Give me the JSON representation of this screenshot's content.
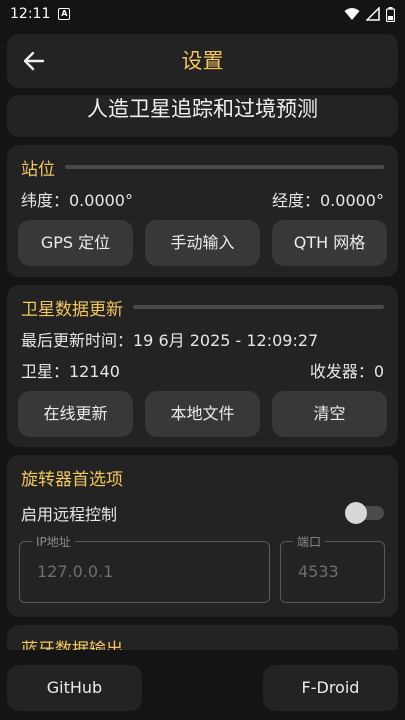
{
  "status_bar": {
    "time": "12:11",
    "notification_letter": "A"
  },
  "top_bar": {
    "title": "设置"
  },
  "app_title": "人造卫星追踪和过境预测",
  "station": {
    "title": "站位",
    "latitude_label": "纬度：0.0000°",
    "longitude_label": "经度：0.0000°",
    "buttons": [
      "GPS 定位",
      "手动输入",
      "QTH 网格"
    ]
  },
  "satellite_data": {
    "title": "卫星数据更新",
    "last_update": "最后更新时间：19 6月 2025 - 12:09:27",
    "satellites": "卫星：12140",
    "transceivers": "收发器：0",
    "buttons": [
      "在线更新",
      "本地文件",
      "清空"
    ]
  },
  "rotator": {
    "title": "旋转器首选项",
    "remote_label": "启用远程控制",
    "remote_enabled": false,
    "ip_label": "IP地址",
    "ip_value": "127.0.0.1",
    "port_label": "端口",
    "port_value": "4533"
  },
  "bluetooth": {
    "title": "蓝牙数据输出"
  },
  "bottom_bar": {
    "github": "GitHub",
    "fdroid": "F-Droid"
  },
  "colors": {
    "accent": "#f3c75c",
    "background": "#141414",
    "card": "#232323",
    "button": "#383838"
  }
}
